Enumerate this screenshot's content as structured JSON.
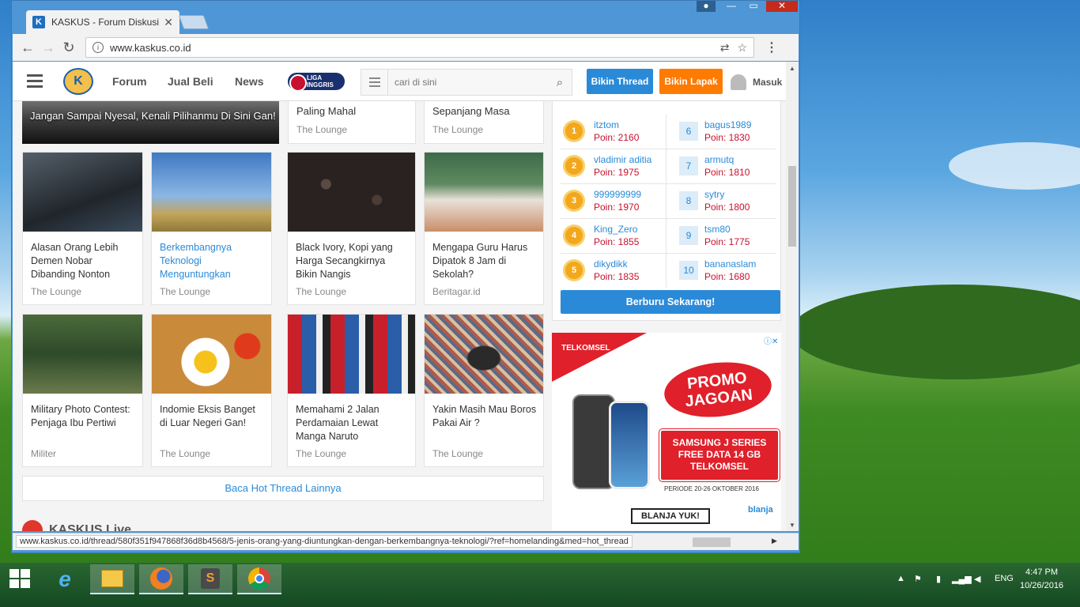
{
  "browser": {
    "tab_title": "KASKUS - Forum Diskusi",
    "url": "www.kaskus.co.id",
    "favicon_letter": "K",
    "status_url": "www.kaskus.co.id/thread/580f351f947868f36d8b4568/5-jenis-orang-yang-diuntungkan-dengan-berkembangnya-teknologi/?ref=homelanding&med=hot_thread"
  },
  "header": {
    "logo_letter": "K",
    "nav": [
      "Forum",
      "Jual Beli",
      "News"
    ],
    "liga_label": "LIGA INGGRIS",
    "search_placeholder": "cari di sini",
    "bikin_thread": "Bikin Thread",
    "bikin_lapak": "Bikin Lapak",
    "masuk": "Masuk"
  },
  "top_row": [
    {
      "title": "Jangan Sampai Nyesal, Kenali Pilihanmu Di Sini Gan!"
    },
    {
      "title": "Paling Mahal",
      "category": "The Lounge"
    },
    {
      "title": "Sepanjang Masa",
      "category": "The Lounge"
    }
  ],
  "threads": [
    {
      "title": "Alasan Orang Lebih Demen Nobar Dibanding Nonton",
      "category": "The Lounge"
    },
    {
      "title": "Berkembangnya Teknologi Menguntungkan",
      "category": "The Lounge"
    },
    {
      "title": "Black Ivory, Kopi yang Harga Secangkirnya Bikin Nangis",
      "category": "The Lounge"
    },
    {
      "title": "Mengapa Guru Harus Dipatok 8 Jam di Sekolah?",
      "category": "Beritagar.id"
    },
    {
      "title": "Military Photo Contest: Penjaga Ibu Pertiwi",
      "category": "Militer"
    },
    {
      "title": "Indomie Eksis Banget di Luar Negeri Gan!",
      "category": "The Lounge"
    },
    {
      "title": "Memahami 2 Jalan Perdamaian Lewat Manga Naruto",
      "category": "The Lounge"
    },
    {
      "title": "Yakin Masih Mau Boros Pakai Air ?",
      "category": "The Lounge"
    }
  ],
  "more_label": "Baca Hot Thread Lainnya",
  "live_label": "KASKUS Live",
  "leaderboard": {
    "left": [
      {
        "rank": "1",
        "name": "itztom",
        "points": "Poin: 2160"
      },
      {
        "rank": "2",
        "name": "vladimir aditia",
        "points": "Poin: 1975"
      },
      {
        "rank": "3",
        "name": "999999999",
        "points": "Poin: 1970"
      },
      {
        "rank": "4",
        "name": "King_Zero",
        "points": "Poin: 1855"
      },
      {
        "rank": "5",
        "name": "dikydikk",
        "points": "Poin: 1835"
      }
    ],
    "right": [
      {
        "rank": "6",
        "name": "bagus1989",
        "points": "Poin: 1830"
      },
      {
        "rank": "7",
        "name": "armutq",
        "points": "Poin: 1810"
      },
      {
        "rank": "8",
        "name": "sytry",
        "points": "Poin: 1800"
      },
      {
        "rank": "9",
        "name": "tsm80",
        "points": "Poin: 1775"
      },
      {
        "rank": "10",
        "name": "bananaslam",
        "points": "Poin: 1680"
      }
    ],
    "button": "Berburu Sekarang!"
  },
  "ad": {
    "brand": "TELKOMSEL",
    "promo": "PROMO JAGOAN",
    "offer": "SAMSUNG J SERIES FREE DATA 14 GB TELKOMSEL",
    "period": "PERIODE 20-26 OKTOBER 2016",
    "cta": "BLANJA YUK!",
    "partner": "blanja"
  },
  "taskbar": {
    "lang": "ENG",
    "time": "4:47 PM",
    "date": "10/26/2016"
  },
  "colors": {
    "accent": "#2a8ad8",
    "lapak": "#ff7a00",
    "points": "#c8102e"
  }
}
